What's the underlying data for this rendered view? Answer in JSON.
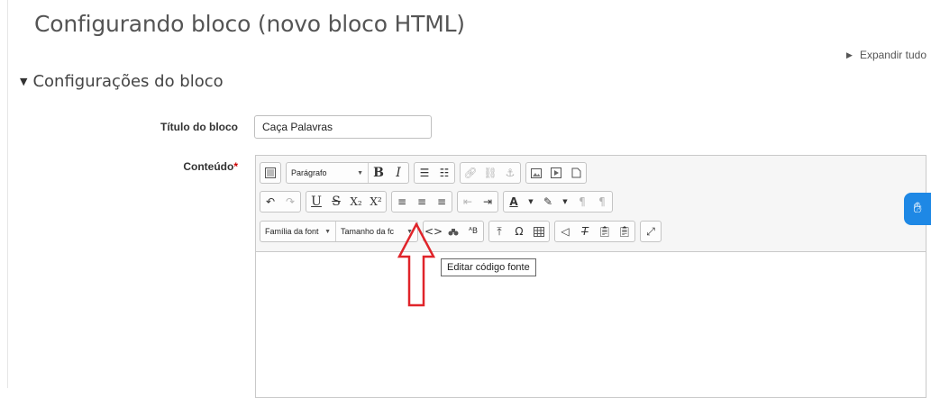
{
  "page": {
    "title": "Configurando bloco (novo bloco HTML)"
  },
  "expand_all": {
    "label": "Expandir tudo"
  },
  "section": {
    "title": "Configurações do bloco"
  },
  "form": {
    "title_label": "Título do bloco",
    "title_value": "Caça Palavras",
    "content_label": "Conteúdo",
    "required_mark": "*"
  },
  "editor": {
    "paragraph_select": "Parágrafo",
    "font_family_select": "Família da font",
    "font_size_select": "Tamanho da fc",
    "tooltip": "Editar código fonte",
    "bold": "B",
    "italic": "I",
    "underline": "U",
    "strike": "S",
    "subscript": "X₂",
    "superscript": "X²",
    "omega": "Ω"
  },
  "accent_colors": {
    "annotation_arrow": "#e0242a",
    "accessibility": "#1e88e5",
    "required": "#cc0000"
  }
}
